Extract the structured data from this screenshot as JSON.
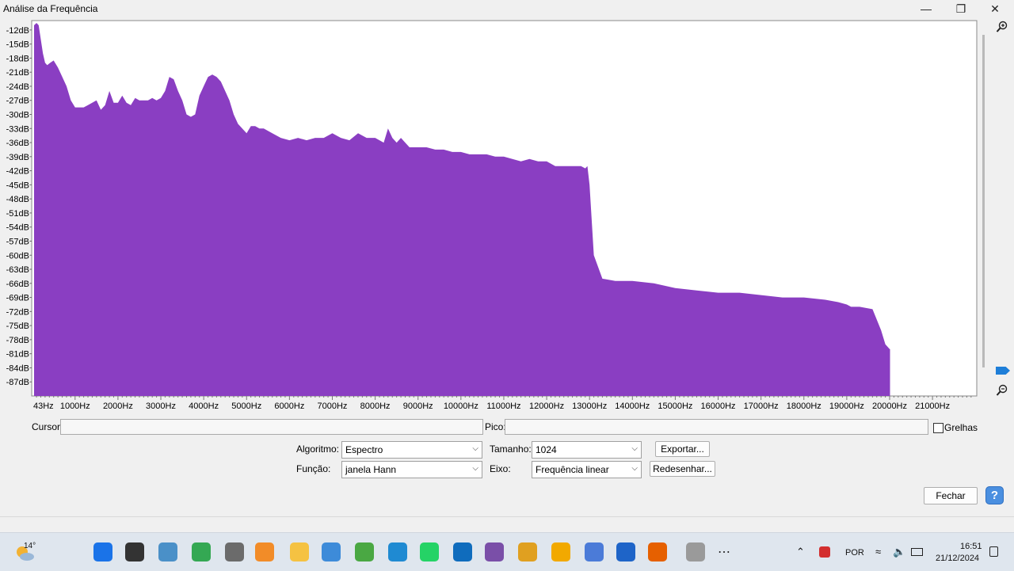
{
  "window": {
    "title": "Análise da Frequência",
    "minimize_glyph": "—",
    "maximize_glyph": "❐",
    "close_glyph": "✕"
  },
  "chart_data": {
    "type": "area",
    "title": "",
    "xlabel": "",
    "ylabel": "",
    "color": "#8a3ec2",
    "xlim": [
      43,
      22000
    ],
    "ylim": [
      -90,
      -10
    ],
    "y_ticks": [
      "-12dB",
      "-15dB",
      "-18dB",
      "-21dB",
      "-24dB",
      "-27dB",
      "-30dB",
      "-33dB",
      "-36dB",
      "-39dB",
      "-42dB",
      "-45dB",
      "-48dB",
      "-51dB",
      "-54dB",
      "-57dB",
      "-60dB",
      "-63dB",
      "-66dB",
      "-69dB",
      "-72dB",
      "-75dB",
      "-78dB",
      "-81dB",
      "-84dB",
      "-87dB"
    ],
    "y_tick_values": [
      -12,
      -15,
      -18,
      -21,
      -24,
      -27,
      -30,
      -33,
      -36,
      -39,
      -42,
      -45,
      -48,
      -51,
      -54,
      -57,
      -60,
      -63,
      -66,
      -69,
      -72,
      -75,
      -78,
      -81,
      -84,
      -87
    ],
    "x_ticks": [
      "43Hz",
      "1000Hz",
      "2000Hz",
      "3000Hz",
      "4000Hz",
      "5000Hz",
      "6000Hz",
      "7000Hz",
      "8000Hz",
      "9000Hz",
      "10000Hz",
      "11000Hz",
      "12000Hz",
      "13000Hz",
      "14000Hz",
      "15000Hz",
      "16000Hz",
      "17000Hz",
      "18000Hz",
      "19000Hz",
      "20000Hz",
      "21000Hz"
    ],
    "x_tick_values": [
      43,
      1000,
      2000,
      3000,
      4000,
      5000,
      6000,
      7000,
      8000,
      9000,
      10000,
      11000,
      12000,
      13000,
      14000,
      15000,
      16000,
      17000,
      18000,
      19000,
      20000,
      21000
    ],
    "x": [
      43,
      100,
      150,
      200,
      250,
      300,
      350,
      420,
      500,
      600,
      700,
      800,
      900,
      1000,
      1100,
      1200,
      1300,
      1500,
      1600,
      1700,
      1800,
      1900,
      2000,
      2100,
      2200,
      2300,
      2400,
      2500,
      2600,
      2700,
      2800,
      2900,
      3000,
      3100,
      3200,
      3300,
      3400,
      3500,
      3600,
      3700,
      3800,
      3900,
      4000,
      4100,
      4200,
      4300,
      4400,
      4500,
      4600,
      4700,
      4800,
      5000,
      5100,
      5200,
      5300,
      5400,
      5600,
      5800,
      6000,
      6200,
      6400,
      6600,
      6800,
      7000,
      7200,
      7400,
      7600,
      7800,
      8000,
      8200,
      8300,
      8400,
      8500,
      8600,
      8800,
      9000,
      9200,
      9400,
      9600,
      9800,
      10000,
      10200,
      10400,
      10600,
      10800,
      11000,
      11200,
      11400,
      11600,
      11800,
      12000,
      12200,
      12400,
      12600,
      12800,
      12900,
      12950,
      13000,
      13100,
      13300,
      13600,
      14000,
      14500,
      15000,
      15500,
      16000,
      16500,
      17000,
      17500,
      18000,
      18500,
      18800,
      19000,
      19100,
      19300,
      19600,
      19800,
      19900,
      20000,
      20010
    ],
    "y": [
      -11,
      -10.5,
      -11,
      -14,
      -17,
      -19,
      -19.5,
      -19,
      -18.5,
      -20,
      -22,
      -24,
      -27,
      -28.5,
      -28.5,
      -28.5,
      -28,
      -27,
      -29,
      -28,
      -25,
      -27.5,
      -27.5,
      -26,
      -27.5,
      -28,
      -26.5,
      -27,
      -27,
      -27,
      -26.5,
      -27,
      -26.5,
      -25,
      -22,
      -22.5,
      -25,
      -27,
      -30,
      -30.5,
      -30,
      -26,
      -24,
      -22,
      -21.5,
      -22,
      -23,
      -25,
      -27,
      -30,
      -32,
      -34,
      -32.5,
      -32.5,
      -33,
      -33,
      -34,
      -35,
      -35.5,
      -35,
      -35.5,
      -35,
      -35,
      -34,
      -35,
      -35.5,
      -34,
      -35,
      -35,
      -36,
      -33,
      -35,
      -36,
      -35,
      -37,
      -37,
      -37,
      -37.5,
      -37.5,
      -38,
      -38,
      -38.5,
      -38.5,
      -38.5,
      -39,
      -39,
      -39.5,
      -40,
      -39.5,
      -40,
      -40,
      -41,
      -41,
      -41,
      -41,
      -41.5,
      -41,
      -45,
      -60,
      -65,
      -65.5,
      -65.5,
      -66,
      -67,
      -67.5,
      -68,
      -68,
      -68.5,
      -69,
      -69,
      -69.5,
      -70,
      -70.5,
      -71,
      -71,
      -71.5,
      -76,
      -79,
      -80,
      -80,
      -80,
      -80,
      -81,
      -91
    ]
  },
  "controls": {
    "cursor_label": "Cursor:",
    "peak_label": "Pico:",
    "grid_label": "Grelhas",
    "algorithm_label": "Algoritmo:",
    "algorithm_value": "Espectro",
    "function_label": "Função:",
    "function_value": "janela Hann",
    "size_label": "Tamanho:",
    "size_value": "1024",
    "axis_label": "Eixo:",
    "axis_value": "Frequência linear",
    "export_label": "Exportar...",
    "redraw_label": "Redesenhar...",
    "close_label": "Fechar",
    "help_glyph": "?"
  },
  "taskbar": {
    "weather_temp": "14°",
    "language": "POR",
    "time": "16:51",
    "date": "21/12/2024",
    "apps": [
      {
        "name": "start-icon",
        "color": "#1a73e8"
      },
      {
        "name": "search-icon",
        "color": "#333333"
      },
      {
        "name": "control-panel-icon",
        "color": "#4a90c8"
      },
      {
        "name": "chrome-icon",
        "color": "#34a853"
      },
      {
        "name": "calculator-icon",
        "color": "#6b6b6b"
      },
      {
        "name": "media-player-icon",
        "color": "#f28c28"
      },
      {
        "name": "file-explorer-icon",
        "color": "#f5c242"
      },
      {
        "name": "network-app-icon",
        "color": "#3d8bd9"
      },
      {
        "name": "utorrent-icon",
        "color": "#4aa843"
      },
      {
        "name": "help-app-icon",
        "color": "#1f8ad2"
      },
      {
        "name": "whatsapp-icon",
        "color": "#25d366"
      },
      {
        "name": "outlook-icon",
        "color": "#0f6cbd"
      },
      {
        "name": "audio-app-icon",
        "color": "#7a4fa8"
      },
      {
        "name": "media-app-icon",
        "color": "#e0a020"
      },
      {
        "name": "audacity-icon",
        "color": "#f2a900"
      },
      {
        "name": "plane-app-icon",
        "color": "#4b7bd8"
      },
      {
        "name": "a-app-icon",
        "color": "#1e64c8"
      },
      {
        "name": "firefox-icon",
        "color": "#e66000"
      },
      {
        "name": "document-icon",
        "color": "#9a9a9a"
      }
    ]
  }
}
